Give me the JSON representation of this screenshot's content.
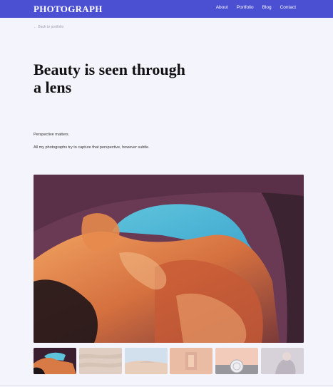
{
  "brand": "PHOTOGRAPH",
  "nav": {
    "links": [
      "About",
      "Portfolio",
      "Blog",
      "Contact"
    ]
  },
  "back_link": "← Back to portfolio",
  "headline": "Beauty is seen through a lens",
  "paragraphs": [
    "Perspective matters.",
    "All my photographs try to capture that perspective, however subtle."
  ],
  "gallery": {
    "selected_index": 0,
    "thumbnails": [
      {
        "subject": "canyon",
        "selected": true
      },
      {
        "subject": "sand-dunes",
        "selected": false
      },
      {
        "subject": "desert",
        "selected": false
      },
      {
        "subject": "corridor",
        "selected": false
      },
      {
        "subject": "clock",
        "selected": false
      },
      {
        "subject": "portrait",
        "selected": false
      }
    ]
  },
  "colors": {
    "nav_bg": "#4b4fd2",
    "page_bg": "#f4f4fc"
  }
}
